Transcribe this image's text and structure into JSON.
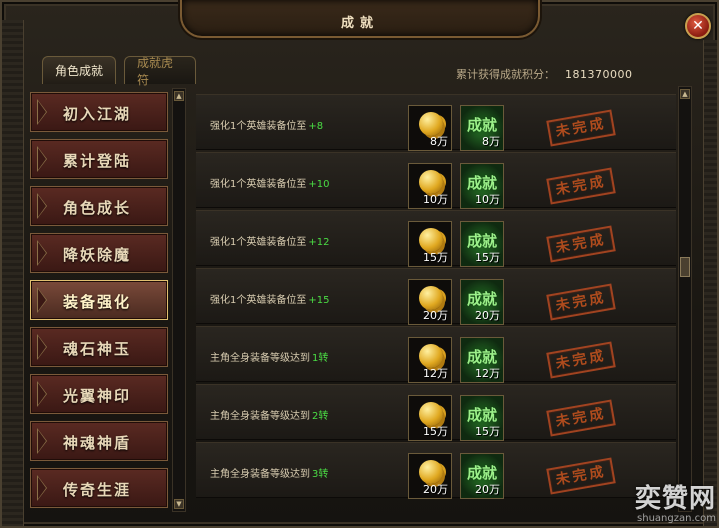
{
  "window": {
    "title": "成就",
    "close_icon": "close-icon"
  },
  "tabs": [
    {
      "label": "角色成就",
      "active": true
    },
    {
      "label": "成就虎符",
      "active": false
    }
  ],
  "points": {
    "label": "累计获得成就积分：",
    "value": "181370000"
  },
  "sidebar": {
    "items": [
      {
        "label": "初入江湖",
        "active": false
      },
      {
        "label": "累计登陆",
        "active": false
      },
      {
        "label": "角色成长",
        "active": false
      },
      {
        "label": "降妖除魔",
        "active": false
      },
      {
        "label": "装备强化",
        "active": true
      },
      {
        "label": "魂石神玉",
        "active": false
      },
      {
        "label": "光翼神印",
        "active": false
      },
      {
        "label": "神魂神盾",
        "active": false
      },
      {
        "label": "传奇生涯",
        "active": false
      }
    ]
  },
  "achievements": [
    {
      "desc": "强化1个英雄装备位至",
      "level": "+8",
      "coin": "8万",
      "reward_label": "成就",
      "reward": "8万",
      "status": "未完成"
    },
    {
      "desc": "强化1个英雄装备位至",
      "level": "+10",
      "coin": "10万",
      "reward_label": "成就",
      "reward": "10万",
      "status": "未完成"
    },
    {
      "desc": "强化1个英雄装备位至",
      "level": "+12",
      "coin": "15万",
      "reward_label": "成就",
      "reward": "15万",
      "status": "未完成"
    },
    {
      "desc": "强化1个英雄装备位至",
      "level": "+15",
      "coin": "20万",
      "reward_label": "成就",
      "reward": "20万",
      "status": "未完成"
    },
    {
      "desc": "主角全身装备等级达到",
      "level": "1转",
      "coin": "12万",
      "reward_label": "成就",
      "reward": "12万",
      "status": "未完成"
    },
    {
      "desc": "主角全身装备等级达到",
      "level": "2转",
      "coin": "15万",
      "reward_label": "成就",
      "reward": "15万",
      "status": "未完成"
    },
    {
      "desc": "主角全身装备等级达到",
      "level": "3转",
      "coin": "20万",
      "reward_label": "成就",
      "reward": "20万",
      "status": "未完成"
    }
  ],
  "watermark": {
    "logo": "奕赞网",
    "url": "shuangzan.com"
  },
  "colors": {
    "level_green": "#4adc44",
    "stamp_red": "#c8541e",
    "gold_border": "#e0c070"
  }
}
